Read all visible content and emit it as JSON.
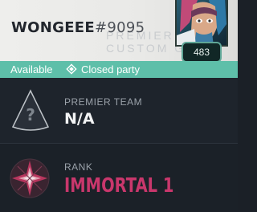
{
  "player": {
    "name": "WONGEEE",
    "tag": "#9095",
    "level": "483"
  },
  "header_ghost_text": "PREMIER  CUSTOM  G",
  "status": {
    "availability": "Available",
    "party": "Closed party",
    "color": "#5ebfa9"
  },
  "premier": {
    "label": "PREMIER TEAM",
    "value": "N/A"
  },
  "rank": {
    "label": "RANK",
    "value": "IMMORTAL 1",
    "color": "#c9376c"
  },
  "icons": {
    "premier": "premier-team-unknown-icon",
    "rank": "immortal-rank-icon",
    "party": "closed-party-icon",
    "avatar": "player-card-avatar"
  }
}
